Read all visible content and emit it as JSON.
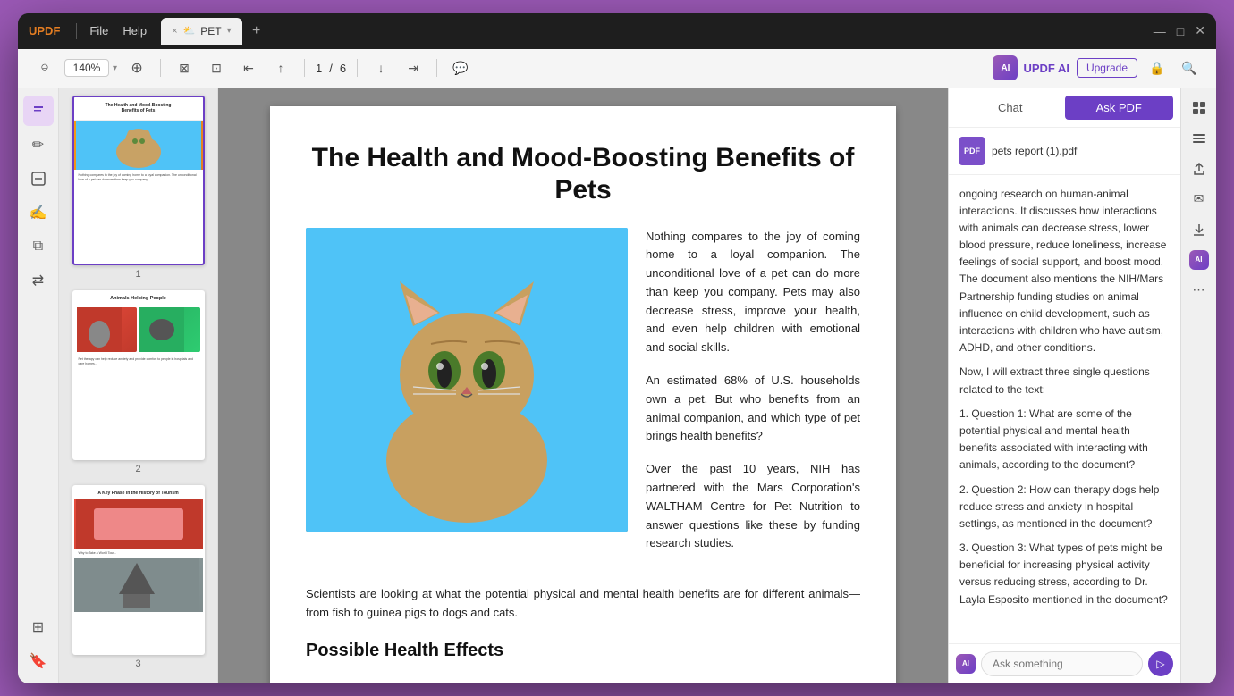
{
  "app": {
    "logo": "UPDF",
    "menus": [
      "File",
      "Help"
    ],
    "tab": {
      "close_icon": "×",
      "label": "PET",
      "add_icon": "+"
    },
    "window_controls": {
      "minimize": "—",
      "maximize": "□",
      "close": "✕"
    }
  },
  "toolbar": {
    "zoom_out": "−",
    "zoom_value": "140%",
    "zoom_in": "+",
    "fit_page": "⊠",
    "fit_width": "⊡",
    "page_current": "1",
    "page_sep": "/",
    "page_total": "6",
    "nav_first": "«",
    "nav_prev": "‹",
    "nav_next": "›",
    "nav_last": "»",
    "comment": "💬",
    "updf_ai_label": "UPDF AI",
    "upgrade_label": "Upgrade",
    "lock_icon": "🔒",
    "search_icon": "🔍"
  },
  "left_toolbar": {
    "tools": [
      {
        "name": "edit-tool",
        "icon": "✎"
      },
      {
        "name": "annotate-tool",
        "icon": "✏"
      },
      {
        "name": "stamp-tool",
        "icon": "⬜"
      },
      {
        "name": "sign-tool",
        "icon": "✍"
      },
      {
        "name": "organize-tool",
        "icon": "⧉"
      },
      {
        "name": "convert-tool",
        "icon": "⇄"
      }
    ],
    "bottom_tools": [
      {
        "name": "layers-tool",
        "icon": "⊞"
      },
      {
        "name": "bookmark-tool",
        "icon": "🔖"
      }
    ]
  },
  "thumbnails": [
    {
      "num": "1",
      "selected": true
    },
    {
      "num": "2",
      "selected": false
    },
    {
      "num": "3",
      "selected": false
    }
  ],
  "pdf": {
    "title": "The Health and Mood-Boosting Benefits of Pets",
    "paragraph1": "Nothing compares to the joy of coming home to a loyal companion. The unconditional love of a pet can do more than keep you company. Pets may also decrease stress, improve your health, and even help children with emotional and social skills.",
    "paragraph2": "An estimated 68% of U.S. households own a pet. But who benefits from an animal companion, and which type of pet brings health benefits?",
    "paragraph3": "Over the past 10 years, NIH has partnered with the Mars Corporation's WALTHAM Centre for Pet Nutrition to answer questions like these by funding research studies.",
    "bottom_text": "Scientists are looking at what the potential physical and mental health benefits are for different animals—from fish to guinea pigs to dogs and cats.",
    "section_title": "Possible Health Effects"
  },
  "ai_panel": {
    "tabs": [
      "Chat",
      "Ask PDF"
    ],
    "active_tab": "Ask PDF",
    "file_name": "pets report (1).pdf",
    "file_type": "PDF",
    "message_content": "ongoing research on human-animal interactions. It discusses how interactions with animals can decrease stress, lower blood pressure, reduce loneliness, increase feelings of social support, and boost mood. The document also mentions the NIH/Mars Partnership funding studies on animal influence on child development, such as interactions with children who have autism, ADHD, and other conditions.\n\nNow, I will extract three single questions related to the text:\n\n1. Question 1: What are some of the potential physical and mental health benefits associated with interacting with animals, according to the document?\n2. Question 2: How can therapy dogs help reduce stress and anxiety in hospital settings, as mentioned in the document?\n3. Question 3: What types of pets might be beneficial for increasing physical activity versus reducing stress, according to Dr. Layla Esposito mentioned in the document?",
    "input_placeholder": "Ask something",
    "send_icon": "▷"
  },
  "right_sidebar": {
    "tools": [
      {
        "name": "view-mode-icon",
        "icon": "⊞"
      },
      {
        "name": "properties-icon",
        "icon": "☰"
      },
      {
        "name": "share-icon",
        "icon": "↑"
      },
      {
        "name": "mail-icon",
        "icon": "✉"
      },
      {
        "name": "download-icon",
        "icon": "⬇"
      },
      {
        "name": "star-icon",
        "icon": "★"
      },
      {
        "name": "more-icon",
        "icon": "⋯"
      }
    ]
  }
}
